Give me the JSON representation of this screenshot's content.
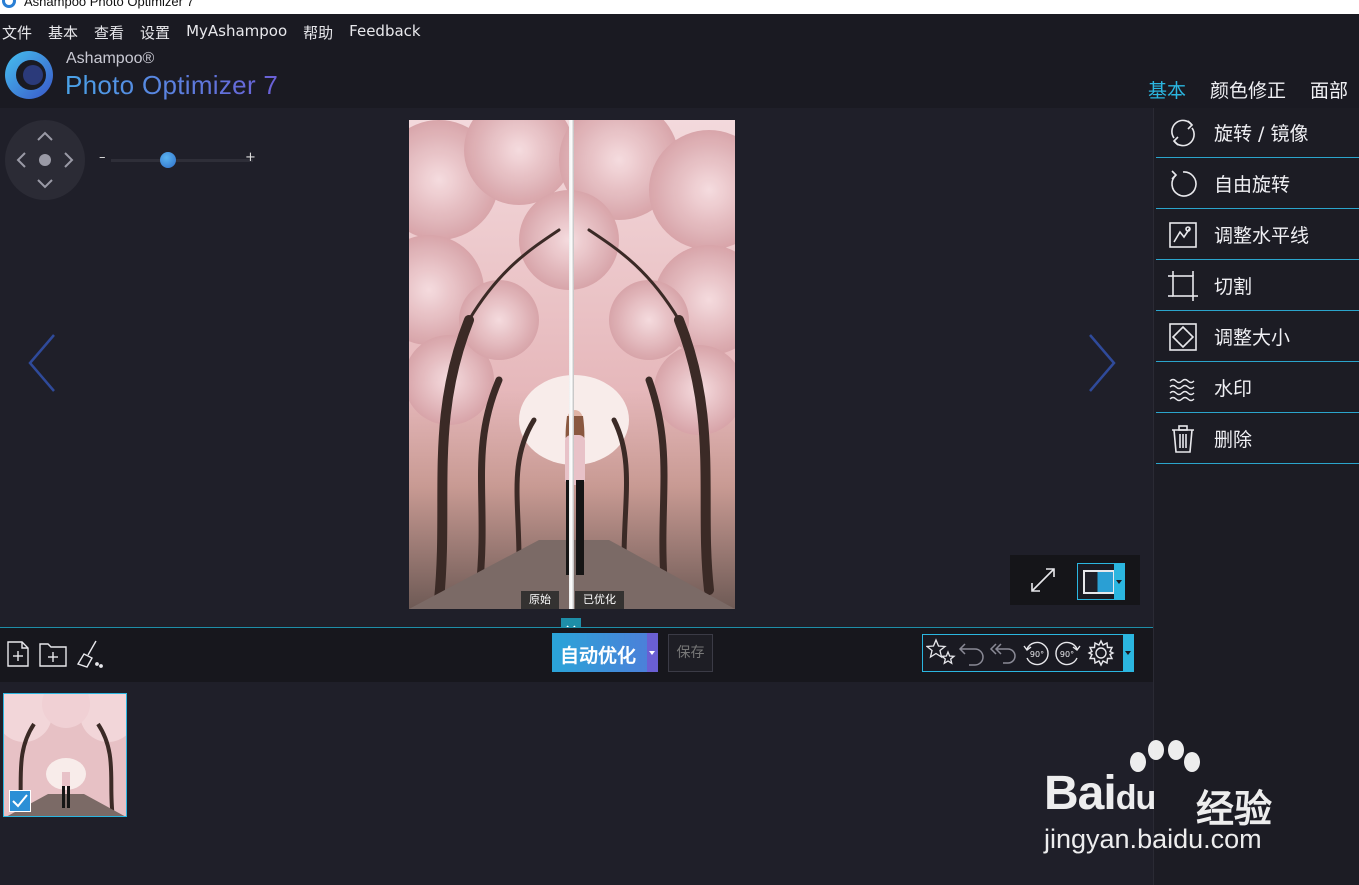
{
  "window": {
    "title": "Ashampoo Photo Optimizer 7"
  },
  "menu": [
    "文件",
    "基本",
    "查看",
    "设置",
    "MyAshampoo",
    "帮助",
    "Feedback"
  ],
  "brand": {
    "company": "Ashampoo®",
    "product": "Photo Optimizer 7"
  },
  "tabs": [
    {
      "label": "基本",
      "active": true
    },
    {
      "label": "颜色修正",
      "active": false
    },
    {
      "label": "面部",
      "active": false
    }
  ],
  "zoom": {
    "minus": "–",
    "plus": "+",
    "level": 0.4
  },
  "compare": {
    "original": "原始",
    "optimized": "已优化"
  },
  "tools": [
    {
      "label": "旋转 / 镜像",
      "icon": "rotate-mirror-icon"
    },
    {
      "label": "自由旋转",
      "icon": "free-rotate-icon"
    },
    {
      "label": "调整水平线",
      "icon": "horizon-icon"
    },
    {
      "label": "切割",
      "icon": "crop-icon"
    },
    {
      "label": "调整大小",
      "icon": "resize-icon"
    },
    {
      "label": "水印",
      "icon": "watermark-icon"
    },
    {
      "label": "删除",
      "icon": "trash-icon"
    }
  ],
  "toolbar": {
    "auto_optimize": "自动优化",
    "save": "保存",
    "rotate_left": "90°",
    "rotate_right": "90°"
  },
  "watermark": {
    "brand": "Bai",
    "brand_suffix": "du",
    "cn": "经验",
    "url": "jingyan.baidu.com"
  },
  "colors": {
    "accent": "#2bb6e0",
    "bg": "#1f1f29",
    "panel": "#1a1a22"
  }
}
